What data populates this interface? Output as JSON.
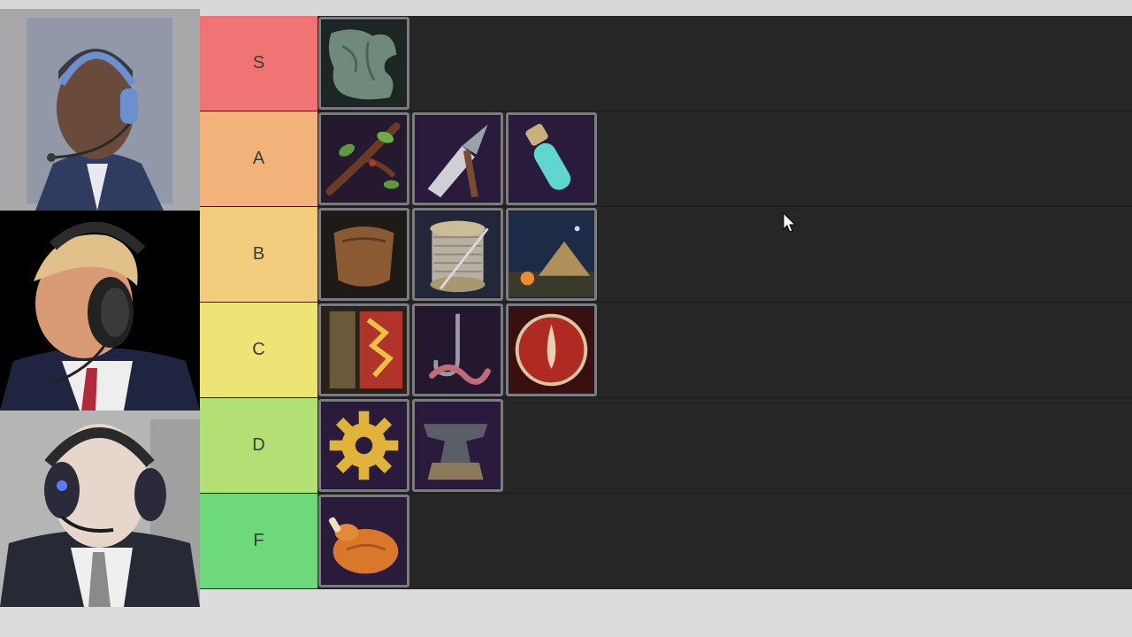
{
  "tiers": [
    {
      "label": "S",
      "color": "#f07474"
    },
    {
      "label": "A",
      "color": "#f2b27a"
    },
    {
      "label": "B",
      "color": "#f2cd7e"
    },
    {
      "label": "C",
      "color": "#eee476"
    },
    {
      "label": "D",
      "color": "#b2e074"
    },
    {
      "label": "F",
      "color": "#6ed97a"
    }
  ],
  "items": {
    "S": [
      "hide-pelt-icon"
    ],
    "A": [
      "branch-with-leaves-icon",
      "spear-icon",
      "potion-vial-icon"
    ],
    "B": [
      "leather-scrap-icon",
      "thread-spool-icon",
      "campfire-tent-icon"
    ],
    "C": [
      "rune-plank-icon",
      "fishing-hook-icon",
      "blood-drop-icon"
    ],
    "D": [
      "gear-icon",
      "anvil-icon"
    ],
    "F": [
      "roast-chicken-icon"
    ]
  }
}
